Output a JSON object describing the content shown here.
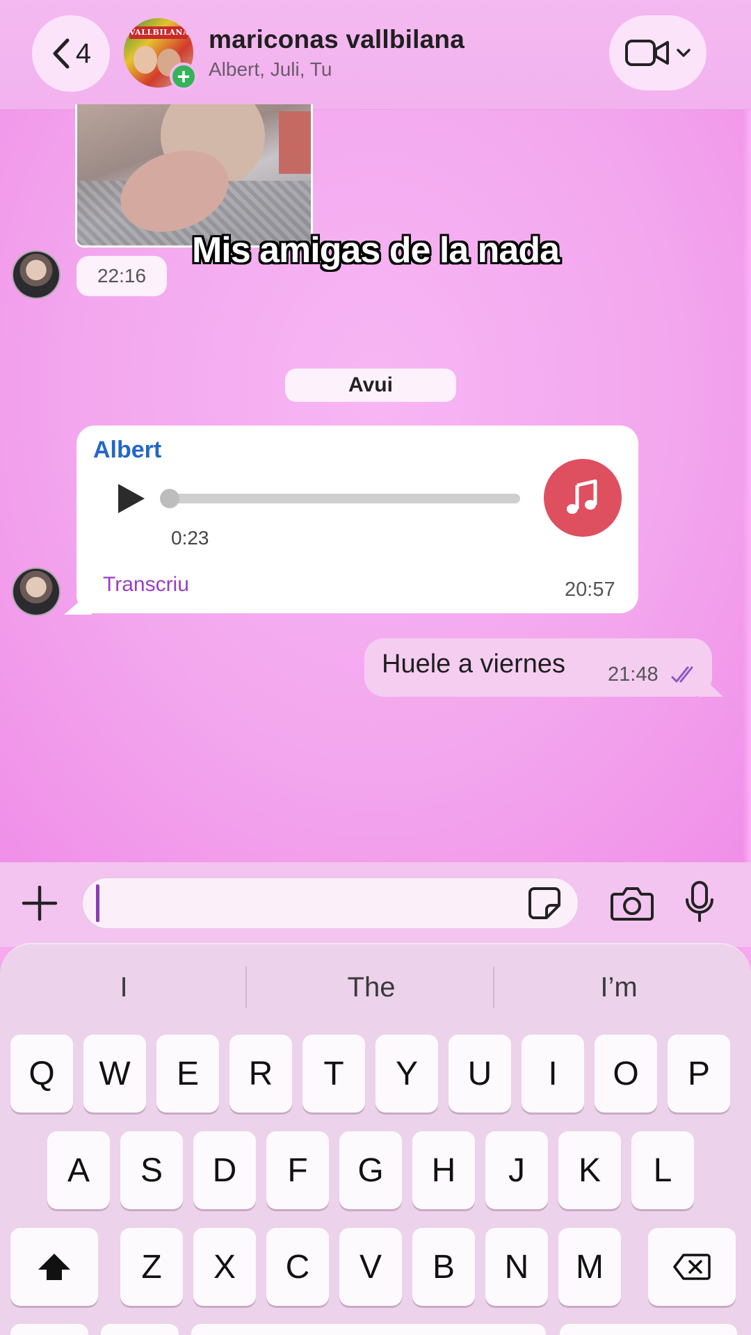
{
  "header": {
    "back_count": "4",
    "group_avatar_text": "VALLBILANA",
    "title": "mariconas vallbilana",
    "subtitle": "Albert, Juli, Tu",
    "video_icon": "video-camera-icon"
  },
  "messages": {
    "image_time": "22:16",
    "overlay_caption": "Mis amigas de la nada",
    "date_divider": "Avui",
    "voice": {
      "sender": "Albert",
      "duration": "0:23",
      "progress": 0,
      "transcribe_label": "Transcriu",
      "time": "20:57"
    },
    "outgoing": {
      "text": "Huele a viernes",
      "time": "21:48",
      "status_icon": "double-check-icon"
    }
  },
  "input": {
    "value": "",
    "icons": [
      "plus-icon",
      "sticker-icon",
      "camera-icon",
      "microphone-icon"
    ]
  },
  "keyboard": {
    "suggestions": [
      "I",
      "The",
      "I’m"
    ],
    "row1": [
      "Q",
      "W",
      "E",
      "R",
      "T",
      "Y",
      "U",
      "I",
      "O",
      "P"
    ],
    "row2": [
      "A",
      "S",
      "D",
      "F",
      "G",
      "H",
      "J",
      "K",
      "L"
    ],
    "row3": [
      "Z",
      "X",
      "C",
      "V",
      "B",
      "N",
      "M"
    ]
  },
  "colors": {
    "chat_background": "#f3a7ee",
    "sender_name": "#2466c7",
    "transcribe": "#9b3ec0",
    "music_icon_bg": "#de4f60",
    "outgoing_bubble": "#f4cdf1"
  }
}
